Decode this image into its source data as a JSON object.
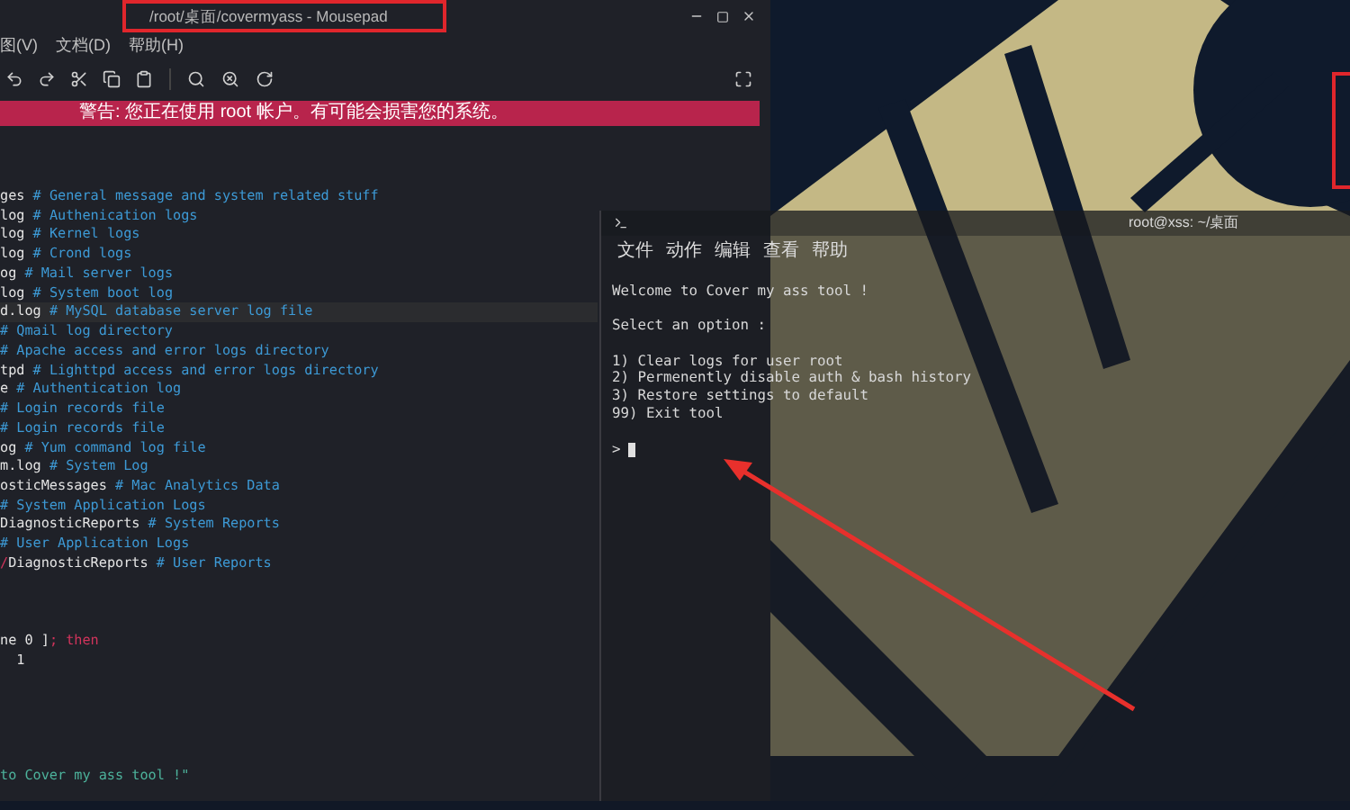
{
  "editor": {
    "title": "/root/桌面/covermyass - Mousepad",
    "menu": [
      "图(V)",
      "文档(D)",
      "帮助(H)"
    ],
    "warning": "警告: 您正在使用 root 帐户。有可能会损害您的系统。",
    "lines": [
      {
        "highlighted": false,
        "segments": [
          {
            "kind": "code",
            "text": "ges "
          },
          {
            "kind": "comment",
            "text": "# General message and system related stuff"
          }
        ]
      },
      {
        "highlighted": false,
        "segments": [
          {
            "kind": "code",
            "text": "log "
          },
          {
            "kind": "comment",
            "text": "# Authenication logs"
          }
        ]
      },
      {
        "highlighted": false,
        "segments": [
          {
            "kind": "code",
            "text": "log "
          },
          {
            "kind": "comment",
            "text": "# Kernel logs"
          }
        ]
      },
      {
        "highlighted": false,
        "segments": [
          {
            "kind": "code",
            "text": "log "
          },
          {
            "kind": "comment",
            "text": "# Crond logs"
          }
        ]
      },
      {
        "highlighted": false,
        "segments": [
          {
            "kind": "code",
            "text": "og "
          },
          {
            "kind": "comment",
            "text": "# Mail server logs"
          }
        ]
      },
      {
        "highlighted": false,
        "segments": [
          {
            "kind": "code",
            "text": "log "
          },
          {
            "kind": "comment",
            "text": "# System boot log"
          }
        ]
      },
      {
        "highlighted": true,
        "segments": [
          {
            "kind": "code",
            "text": "d.log "
          },
          {
            "kind": "comment",
            "text": "# MySQL database server log file"
          }
        ]
      },
      {
        "highlighted": false,
        "segments": [
          {
            "kind": "comment",
            "text": "# Qmail log directory"
          }
        ]
      },
      {
        "highlighted": false,
        "segments": [
          {
            "kind": "comment",
            "text": "# Apache access and error logs directory"
          }
        ]
      },
      {
        "highlighted": false,
        "segments": [
          {
            "kind": "code",
            "text": "tpd "
          },
          {
            "kind": "comment",
            "text": "# Lighttpd access and error logs directory"
          }
        ]
      },
      {
        "highlighted": false,
        "segments": [
          {
            "kind": "code",
            "text": "e "
          },
          {
            "kind": "comment",
            "text": "# Authentication log"
          }
        ]
      },
      {
        "highlighted": false,
        "segments": [
          {
            "kind": "comment",
            "text": "# Login records file"
          }
        ]
      },
      {
        "highlighted": false,
        "segments": [
          {
            "kind": "comment",
            "text": "# Login records file"
          }
        ]
      },
      {
        "highlighted": false,
        "segments": [
          {
            "kind": "code",
            "text": "og "
          },
          {
            "kind": "comment",
            "text": "# Yum command log file"
          }
        ]
      },
      {
        "highlighted": false,
        "segments": [
          {
            "kind": "code",
            "text": "m.log "
          },
          {
            "kind": "comment",
            "text": "# System Log"
          }
        ]
      },
      {
        "highlighted": false,
        "segments": [
          {
            "kind": "code",
            "text": "osticMessages "
          },
          {
            "kind": "comment",
            "text": "# Mac Analytics Data"
          }
        ]
      },
      {
        "highlighted": false,
        "segments": [
          {
            "kind": "comment",
            "text": "# System Application Logs"
          }
        ]
      },
      {
        "highlighted": false,
        "segments": [
          {
            "kind": "code",
            "text": "DiagnosticReports "
          },
          {
            "kind": "comment",
            "text": "# System Reports"
          }
        ]
      },
      {
        "highlighted": false,
        "segments": [
          {
            "kind": "comment",
            "text": "# User Application Logs"
          }
        ]
      },
      {
        "highlighted": false,
        "segments": [
          {
            "kind": "keyword",
            "text": "/"
          },
          {
            "kind": "code",
            "text": "DiagnosticReports "
          },
          {
            "kind": "comment",
            "text": "# User Reports"
          }
        ]
      },
      {
        "kind": "blank"
      },
      {
        "kind": "blank"
      },
      {
        "kind": "blank"
      },
      {
        "highlighted": false,
        "segments": [
          {
            "kind": "code",
            "text": "ne 0 ]"
          },
          {
            "kind": "keyword",
            "text": "; then"
          }
        ]
      },
      {
        "highlighted": false,
        "segments": [
          {
            "kind": "code",
            "text": "  1"
          }
        ]
      },
      {
        "kind": "blank"
      },
      {
        "kind": "blank"
      },
      {
        "kind": "blank"
      },
      {
        "kind": "blank"
      },
      {
        "kind": "blank"
      },
      {
        "highlighted": false,
        "segments": [
          {
            "kind": "string",
            "text": "to Cover my ass tool !\""
          }
        ]
      }
    ]
  },
  "terminal": {
    "title": "root@xss: ~/桌面",
    "menu": [
      "文件",
      "动作",
      "编辑",
      "查看",
      "帮助"
    ],
    "welcome": "Welcome to Cover my ass tool !",
    "select_label": "Select an option :",
    "options": [
      "1) Clear logs for user root",
      "2) Permenently disable auth & bash history",
      "3) Restore settings to default",
      "99) Exit tool"
    ],
    "prompt": ">"
  }
}
